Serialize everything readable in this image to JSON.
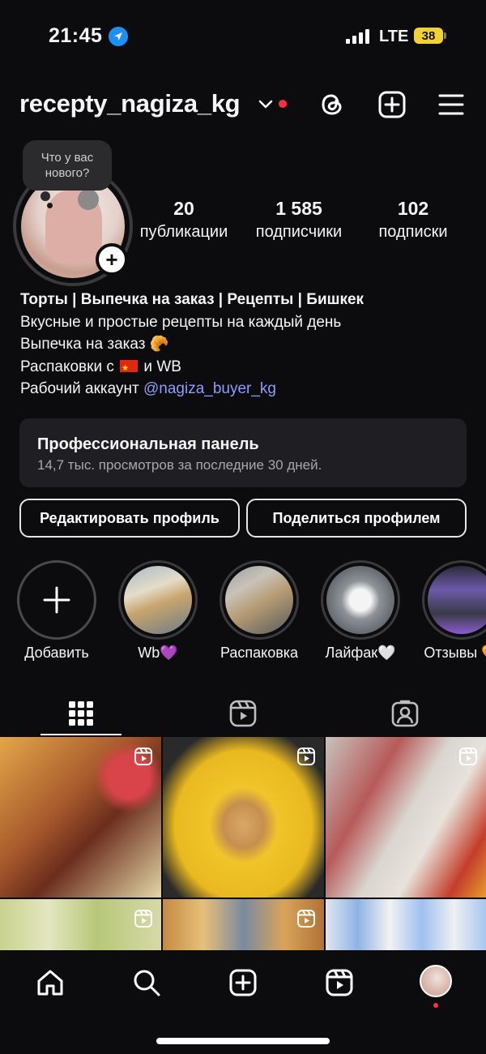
{
  "status_bar": {
    "time": "21:45",
    "network": "LTE",
    "battery": "38"
  },
  "header": {
    "username": "recepty_nagiza_kg"
  },
  "profile": {
    "story_prompt": "Что у вас нового?",
    "stats": [
      {
        "value": "20",
        "label": "публикации"
      },
      {
        "value": "1 585",
        "label": "подписчики"
      },
      {
        "value": "102",
        "label": "подписки"
      }
    ]
  },
  "bio": {
    "title": "Торты | Выпечка на заказ | Рецепты | Бишкек",
    "line1": "Вкусные и простые рецепты на каждый день",
    "line2": "Выпечка на заказ 🥐",
    "line3_prefix": "Распаковки с",
    "line3_suffix": "и WB",
    "line4_prefix": "Рабочий аккаунт",
    "link": "@nagiza_buyer_kg"
  },
  "dashboard": {
    "title": "Профессиональная панель",
    "subtitle": "14,7 тыс. просмотров за последние 30 дней."
  },
  "buttons": {
    "edit": "Редактировать профиль",
    "share": "Поделиться профилем"
  },
  "highlights": [
    {
      "label": "Добавить"
    },
    {
      "label": "Wb💜"
    },
    {
      "label": "Распаковка"
    },
    {
      "label": "Лайфак🤍"
    },
    {
      "label": "Отзывы 🧡"
    }
  ],
  "tabs": [
    "grid",
    "reels",
    "tagged"
  ],
  "colors": {
    "background": "#0c0c0e",
    "accent_link": "#8e9cff",
    "notification": "#ff2e45",
    "battery": "#f2d230"
  }
}
